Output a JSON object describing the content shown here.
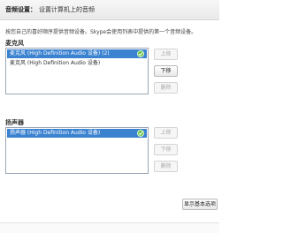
{
  "header": {
    "title": "音频设置：",
    "subtitle": "设置计算机上的音频"
  },
  "description": "按您自己的喜好顺序提供音频设备。Skype会使用列表中提供的第一个音频设备。",
  "microphone": {
    "label": "麦克风",
    "devices": [
      {
        "name": "麦克风 (High Definition Audio 设备) (2)",
        "selected": true,
        "active": true
      },
      {
        "name": "麦克风 (High Definition Audio 设备)",
        "selected": false,
        "active": false
      }
    ],
    "buttons": {
      "up": "上移",
      "down": "下移",
      "delete": "删除"
    }
  },
  "speaker": {
    "label": "扬声器",
    "devices": [
      {
        "name": "扬声器 (High Definition Audio 设备)",
        "selected": true,
        "active": true
      }
    ],
    "buttons": {
      "up": "上移",
      "down": "下移",
      "delete": "删除"
    }
  },
  "footer": {
    "basic_options_label": "显示基本选项"
  },
  "colors": {
    "selection": "#3b83d1",
    "active_check": "#5fbf3c"
  }
}
